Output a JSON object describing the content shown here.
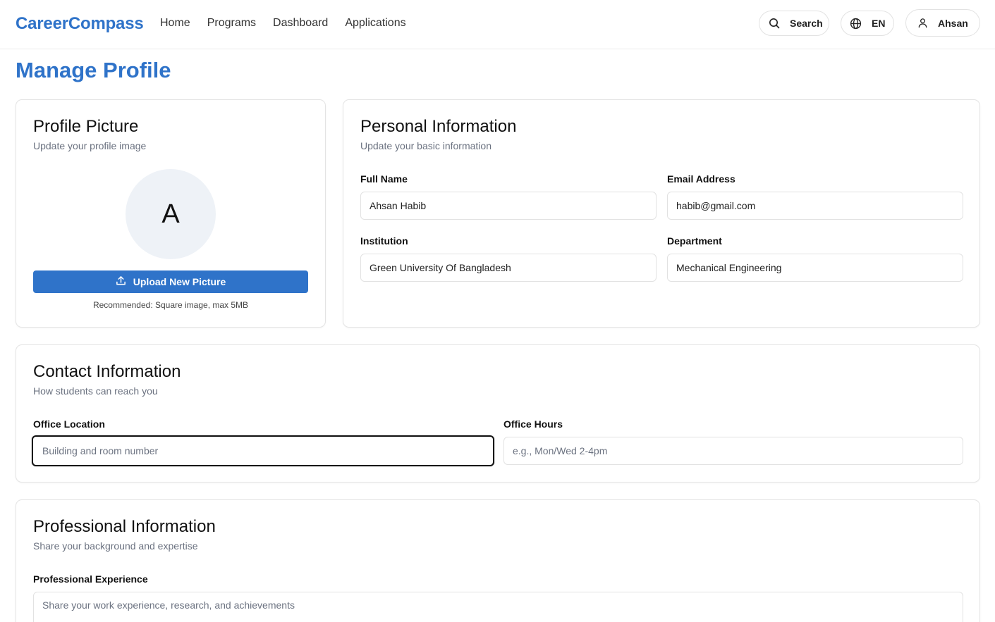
{
  "header": {
    "brand": "CareerCompass",
    "nav": [
      "Home",
      "Programs",
      "Dashboard",
      "Applications"
    ],
    "search_label": "Search",
    "lang_label": "EN",
    "user_label": "Ahsan"
  },
  "page": {
    "title": "Manage Profile"
  },
  "profile_picture": {
    "title": "Profile Picture",
    "subtitle": "Update your profile image",
    "avatar_initial": "A",
    "upload_label": "Upload New Picture",
    "note": "Recommended: Square image, max 5MB"
  },
  "personal_info": {
    "title": "Personal Information",
    "subtitle": "Update your basic information",
    "full_name_label": "Full Name",
    "full_name_value": "Ahsan Habib",
    "email_label": "Email Address",
    "email_value": "habib@gmail.com",
    "institution_label": "Institution",
    "institution_value": "Green University Of Bangladesh",
    "department_label": "Department",
    "department_value": "Mechanical Engineering"
  },
  "contact_info": {
    "title": "Contact Information",
    "subtitle": "How students can reach you",
    "office_location_label": "Office Location",
    "office_location_placeholder": "Building and room number",
    "office_hours_label": "Office Hours",
    "office_hours_placeholder": "e.g., Mon/Wed 2-4pm"
  },
  "professional_info": {
    "title": "Professional Information",
    "subtitle": "Share your background and expertise",
    "experience_label": "Professional Experience",
    "experience_placeholder": "Share your work experience, research, and achievements"
  },
  "colors": {
    "accent": "#2f73c9",
    "muted_text": "#6b7280",
    "border": "#e4e4e4"
  },
  "icons": [
    "search-icon",
    "globe-icon",
    "user-icon",
    "upload-icon"
  ]
}
